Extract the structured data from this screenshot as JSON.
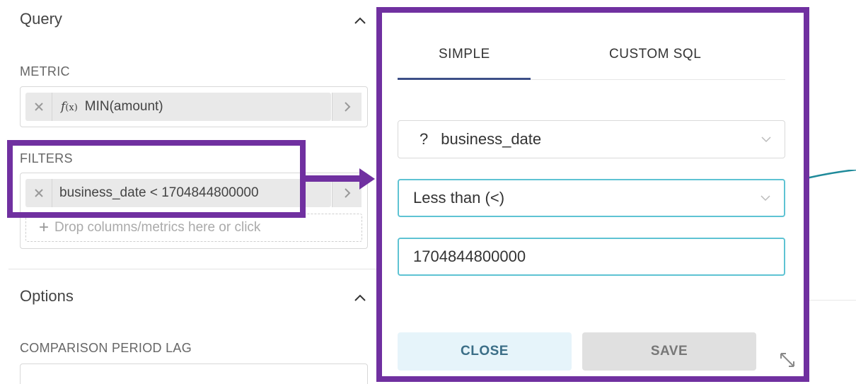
{
  "query_section": {
    "title": "Query",
    "metric_label": "METRIC",
    "metric_fx": "f",
    "metric_fx_sub": "(x)",
    "metric_value": "MIN(amount)",
    "filters_label": "FILTERS",
    "filter_value": "business_date < 1704844800000",
    "drop_placeholder": "Drop columns/metrics here or click"
  },
  "options_section": {
    "title": "Options",
    "comparison_label": "COMPARISON PERIOD LAG",
    "comparison_value": ""
  },
  "popover": {
    "tabs": [
      {
        "label": "SIMPLE",
        "active": true
      },
      {
        "label": "CUSTOM SQL",
        "active": false
      }
    ],
    "column_icon": "?",
    "column_select": "business_date",
    "operator_select": "Less than (<)",
    "value_input": "1704844800000",
    "close_label": "CLOSE",
    "save_label": "SAVE"
  },
  "colors": {
    "annotation": "#7030a0",
    "accent_teal": "#5ec3d3",
    "tab_underline": "#3d4f87"
  }
}
